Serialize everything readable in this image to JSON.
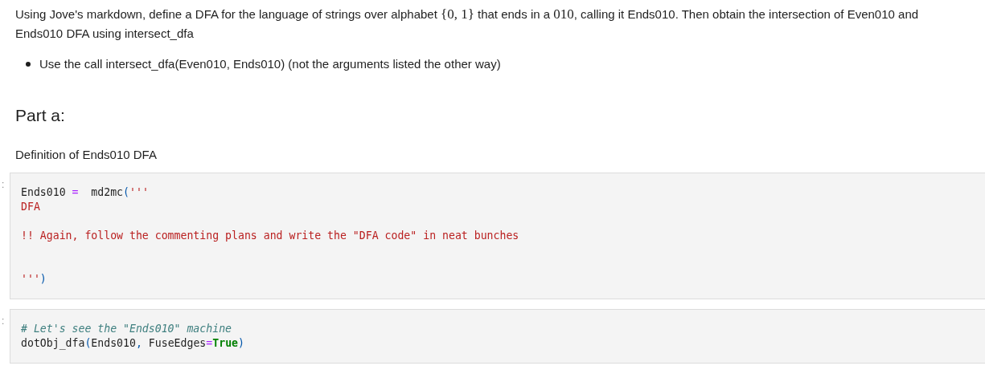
{
  "intro": {
    "segments": [
      {
        "kind": "text",
        "text": "Using Jove's markdown, define a DFA for the language of strings over alphabet "
      },
      {
        "kind": "math",
        "text": "{0, 1}"
      },
      {
        "kind": "text",
        "text": " that ends in a "
      },
      {
        "kind": "math",
        "text": "010"
      },
      {
        "kind": "text",
        "text": ", calling it Ends010. Then obtain the intersection of Even010 and Ends010 DFA using intersect_dfa"
      }
    ]
  },
  "bullets": [
    "Use the call intersect_dfa(Even010, Ends010) (not the arguments listed the other way)"
  ],
  "heading": "Part a:",
  "subtext": "Definition of Ends010 DFA",
  "cells": [
    {
      "prompt": ":",
      "tokens": [
        {
          "kind": "name",
          "text": "Ends010 "
        },
        {
          "kind": "op",
          "text": "="
        },
        {
          "kind": "name",
          "text": "  md2mc"
        },
        {
          "kind": "paren",
          "text": "("
        },
        {
          "kind": "string",
          "text": "'''\nDFA\n\n!! Again, follow the commenting plans and write the \"DFA code\" in neat bunches\n\n\n'''"
        },
        {
          "kind": "paren",
          "text": ")"
        }
      ]
    },
    {
      "prompt": ":",
      "tokens": [
        {
          "kind": "comment",
          "text": "# Let's see the \"Ends010\" machine"
        },
        {
          "kind": "name",
          "text": "\ndotObj_dfa"
        },
        {
          "kind": "paren",
          "text": "("
        },
        {
          "kind": "name",
          "text": "Ends010"
        },
        {
          "kind": "paren",
          "text": ","
        },
        {
          "kind": "name",
          "text": " FuseEdges"
        },
        {
          "kind": "op",
          "text": "="
        },
        {
          "kind": "keyword",
          "text": "True"
        },
        {
          "kind": "paren",
          "text": ")"
        }
      ]
    }
  ]
}
